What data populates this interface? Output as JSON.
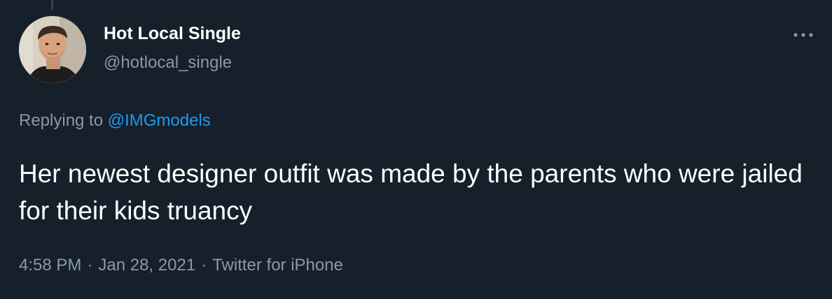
{
  "author": {
    "display_name": "Hot Local Single",
    "handle": "@hotlocal_single"
  },
  "reply": {
    "prefix": "Replying to",
    "mention": "@IMGmodels"
  },
  "tweet": {
    "text": "Her newest designer outfit was made by the parents who were jailed for their kids truancy"
  },
  "meta": {
    "time": "4:58 PM",
    "separator": "·",
    "date": "Jan 28, 2021",
    "source": "Twitter for iPhone"
  },
  "icons": {
    "more": "more-options-icon"
  },
  "colors": {
    "background": "#15202b",
    "text_primary": "#ffffff",
    "text_secondary": "#8b98a5",
    "link": "#1d9bf0"
  }
}
